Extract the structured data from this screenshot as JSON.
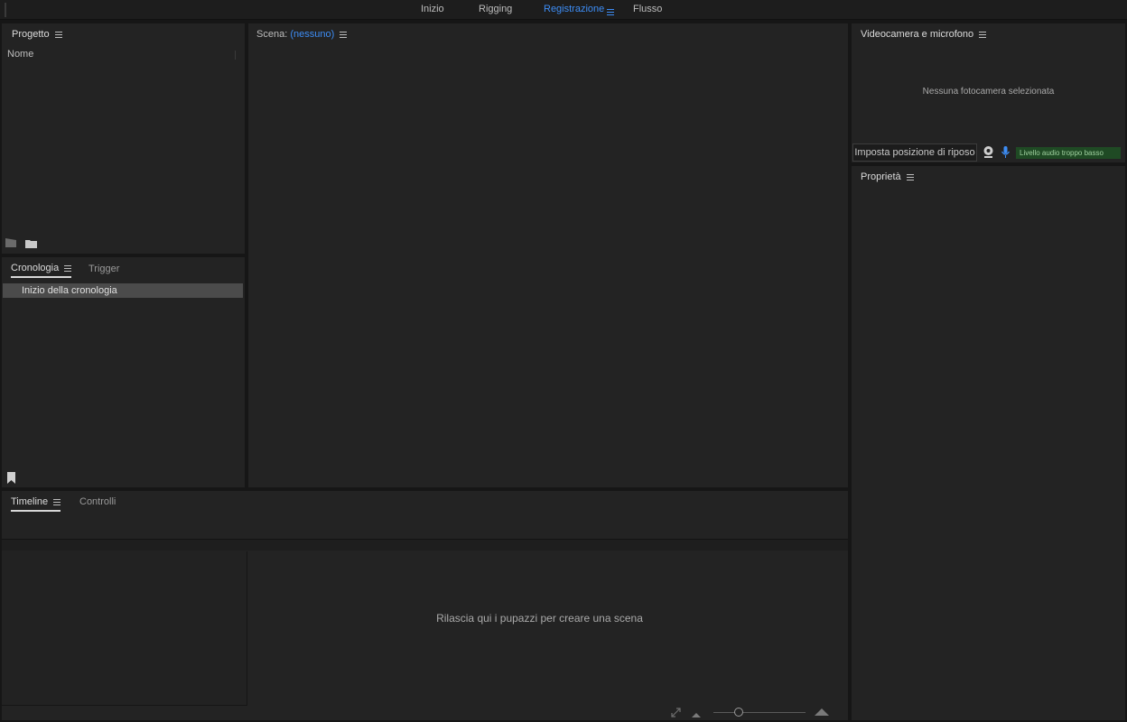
{
  "workspaces": {
    "inizio": "Inizio",
    "rigging": "Rigging",
    "registrazione": "Registrazione",
    "flusso": "Flusso"
  },
  "project": {
    "title": "Progetto",
    "column_name": "Nome"
  },
  "history": {
    "tab_history": "Cronologia",
    "tab_trigger": "Trigger",
    "items": [
      "Inizio della cronologia"
    ]
  },
  "scene": {
    "label": "Scena:",
    "value": "(nessuno)"
  },
  "camera": {
    "title": "Videocamera e microfono",
    "no_camera": "Nessuna fotocamera selezionata",
    "rest_button": "Imposta posizione di riposo",
    "audio_status": "Livello audio troppo basso"
  },
  "properties": {
    "title": "Proprietà"
  },
  "timeline": {
    "tab_timeline": "Timeline",
    "tab_controls": "Controlli",
    "drop_hint": "Rilascia qui i pupazzi per creare una scena",
    "zoom_level": 0.25
  },
  "colors": {
    "accent": "#3d8df5",
    "background": "#161616",
    "panel": "#232323",
    "audio_badge": "#1f4a24"
  },
  "icons": [
    "new-scene-icon",
    "folder-icon",
    "bookmark-icon",
    "webcam-icon",
    "microphone-icon",
    "expand-icon",
    "zoom-out-icon",
    "zoom-in-icon",
    "menu-icon"
  ]
}
